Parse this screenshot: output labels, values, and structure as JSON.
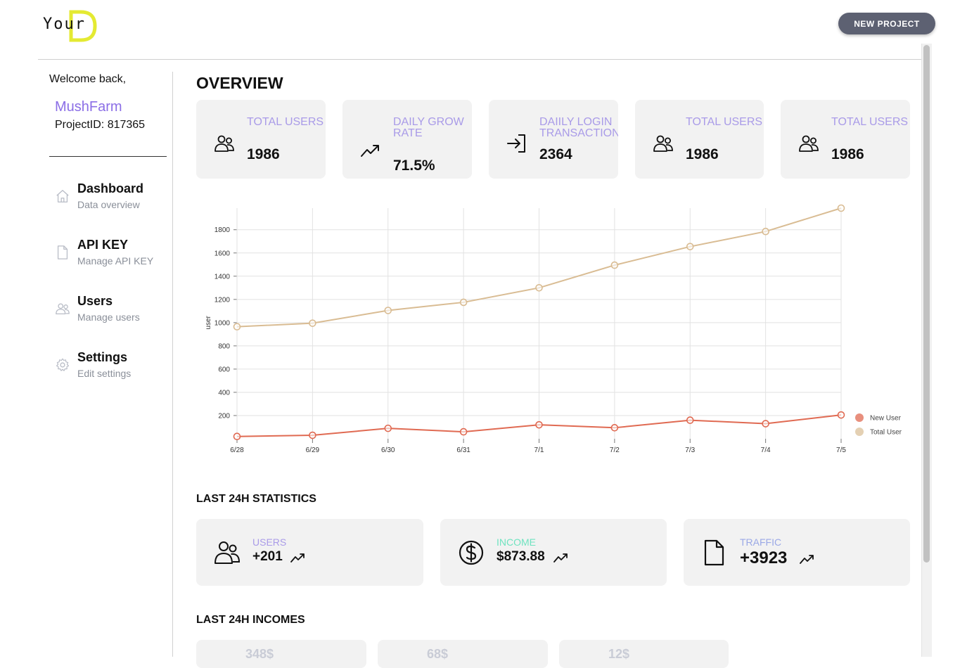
{
  "brand": {
    "logo_text": "Your",
    "logo_letter": "D",
    "logo_color": "#e4ea32"
  },
  "header": {
    "new_project_label": "NEW PROJECT"
  },
  "sidebar": {
    "welcome": "Welcome back,",
    "project_name": "MushFarm",
    "project_id": "ProjectID: 817365",
    "items": [
      {
        "title": "Dashboard",
        "subtitle": "Data overview",
        "icon": "home-icon"
      },
      {
        "title": "API KEY",
        "subtitle": "Manage API KEY",
        "icon": "document-icon"
      },
      {
        "title": "Users",
        "subtitle": "Manage users",
        "icon": "users-icon"
      },
      {
        "title": "Settings",
        "subtitle": "Edit settings",
        "icon": "gear-icon"
      }
    ]
  },
  "overview": {
    "title": "OVERVIEW",
    "cards": [
      {
        "label": "TOTAL USERS",
        "value": "1986",
        "icon": "users-icon"
      },
      {
        "label": "DAILY GROW RATE",
        "value": "71.5%",
        "icon": "trend-up-icon"
      },
      {
        "label": "DAIILY LOGIN TRANSACTION",
        "value": "2364",
        "icon": "login-icon"
      },
      {
        "label": "TOTAL USERS",
        "value": "1986",
        "icon": "users-icon"
      },
      {
        "label": "TOTAL USERS",
        "value": "1986",
        "icon": "users-icon"
      }
    ]
  },
  "chart_data": {
    "type": "line",
    "x": [
      "6/28",
      "6/29",
      "6/30",
      "6/31",
      "7/1",
      "7/2",
      "7/3",
      "7/4",
      "7/5"
    ],
    "ylabel": "user",
    "ylim": [
      0,
      1986
    ],
    "yticks": [
      200,
      400,
      600,
      800,
      1000,
      1200,
      1400,
      1600,
      1800
    ],
    "grid": true,
    "legend_position": "bottom-right",
    "series": [
      {
        "name": "New User",
        "color": "#e06a52",
        "values": [
          20,
          30,
          90,
          60,
          120,
          95,
          160,
          130,
          205
        ]
      },
      {
        "name": "Total User",
        "color": "#d9bc93",
        "values": [
          965,
          995,
          1105,
          1175,
          1300,
          1495,
          1655,
          1785,
          1986
        ]
      }
    ]
  },
  "stats": {
    "title": "LAST 24H STATISTICS",
    "items": [
      {
        "label": "USERS",
        "value": "+201",
        "label_color": "#a99be8",
        "icon": "users-icon"
      },
      {
        "label": "INCOME",
        "value": "$873.88",
        "label_color": "#6fe3c0",
        "icon": "dollar-icon"
      },
      {
        "label": "TRAFFIC",
        "value": "+3923",
        "label_color": "#9aa8e6",
        "icon": "document-icon"
      }
    ]
  },
  "incomes": {
    "title": "LAST 24H INCOMES",
    "items": [
      "348$",
      "68$",
      "12$"
    ]
  }
}
